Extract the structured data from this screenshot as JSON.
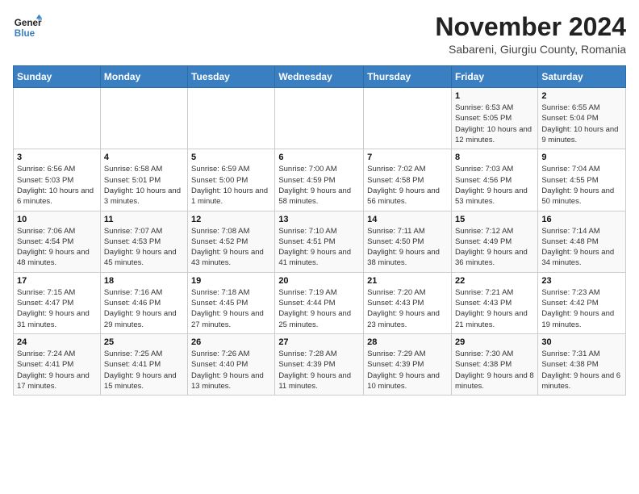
{
  "header": {
    "logo_line1": "General",
    "logo_line2": "Blue",
    "month_title": "November 2024",
    "location": "Sabareni, Giurgiu County, Romania"
  },
  "days_of_week": [
    "Sunday",
    "Monday",
    "Tuesday",
    "Wednesday",
    "Thursday",
    "Friday",
    "Saturday"
  ],
  "weeks": [
    [
      {
        "day": "",
        "info": ""
      },
      {
        "day": "",
        "info": ""
      },
      {
        "day": "",
        "info": ""
      },
      {
        "day": "",
        "info": ""
      },
      {
        "day": "",
        "info": ""
      },
      {
        "day": "1",
        "info": "Sunrise: 6:53 AM\nSunset: 5:05 PM\nDaylight: 10 hours and 12 minutes."
      },
      {
        "day": "2",
        "info": "Sunrise: 6:55 AM\nSunset: 5:04 PM\nDaylight: 10 hours and 9 minutes."
      }
    ],
    [
      {
        "day": "3",
        "info": "Sunrise: 6:56 AM\nSunset: 5:03 PM\nDaylight: 10 hours and 6 minutes."
      },
      {
        "day": "4",
        "info": "Sunrise: 6:58 AM\nSunset: 5:01 PM\nDaylight: 10 hours and 3 minutes."
      },
      {
        "day": "5",
        "info": "Sunrise: 6:59 AM\nSunset: 5:00 PM\nDaylight: 10 hours and 1 minute."
      },
      {
        "day": "6",
        "info": "Sunrise: 7:00 AM\nSunset: 4:59 PM\nDaylight: 9 hours and 58 minutes."
      },
      {
        "day": "7",
        "info": "Sunrise: 7:02 AM\nSunset: 4:58 PM\nDaylight: 9 hours and 56 minutes."
      },
      {
        "day": "8",
        "info": "Sunrise: 7:03 AM\nSunset: 4:56 PM\nDaylight: 9 hours and 53 minutes."
      },
      {
        "day": "9",
        "info": "Sunrise: 7:04 AM\nSunset: 4:55 PM\nDaylight: 9 hours and 50 minutes."
      }
    ],
    [
      {
        "day": "10",
        "info": "Sunrise: 7:06 AM\nSunset: 4:54 PM\nDaylight: 9 hours and 48 minutes."
      },
      {
        "day": "11",
        "info": "Sunrise: 7:07 AM\nSunset: 4:53 PM\nDaylight: 9 hours and 45 minutes."
      },
      {
        "day": "12",
        "info": "Sunrise: 7:08 AM\nSunset: 4:52 PM\nDaylight: 9 hours and 43 minutes."
      },
      {
        "day": "13",
        "info": "Sunrise: 7:10 AM\nSunset: 4:51 PM\nDaylight: 9 hours and 41 minutes."
      },
      {
        "day": "14",
        "info": "Sunrise: 7:11 AM\nSunset: 4:50 PM\nDaylight: 9 hours and 38 minutes."
      },
      {
        "day": "15",
        "info": "Sunrise: 7:12 AM\nSunset: 4:49 PM\nDaylight: 9 hours and 36 minutes."
      },
      {
        "day": "16",
        "info": "Sunrise: 7:14 AM\nSunset: 4:48 PM\nDaylight: 9 hours and 34 minutes."
      }
    ],
    [
      {
        "day": "17",
        "info": "Sunrise: 7:15 AM\nSunset: 4:47 PM\nDaylight: 9 hours and 31 minutes."
      },
      {
        "day": "18",
        "info": "Sunrise: 7:16 AM\nSunset: 4:46 PM\nDaylight: 9 hours and 29 minutes."
      },
      {
        "day": "19",
        "info": "Sunrise: 7:18 AM\nSunset: 4:45 PM\nDaylight: 9 hours and 27 minutes."
      },
      {
        "day": "20",
        "info": "Sunrise: 7:19 AM\nSunset: 4:44 PM\nDaylight: 9 hours and 25 minutes."
      },
      {
        "day": "21",
        "info": "Sunrise: 7:20 AM\nSunset: 4:43 PM\nDaylight: 9 hours and 23 minutes."
      },
      {
        "day": "22",
        "info": "Sunrise: 7:21 AM\nSunset: 4:43 PM\nDaylight: 9 hours and 21 minutes."
      },
      {
        "day": "23",
        "info": "Sunrise: 7:23 AM\nSunset: 4:42 PM\nDaylight: 9 hours and 19 minutes."
      }
    ],
    [
      {
        "day": "24",
        "info": "Sunrise: 7:24 AM\nSunset: 4:41 PM\nDaylight: 9 hours and 17 minutes."
      },
      {
        "day": "25",
        "info": "Sunrise: 7:25 AM\nSunset: 4:41 PM\nDaylight: 9 hours and 15 minutes."
      },
      {
        "day": "26",
        "info": "Sunrise: 7:26 AM\nSunset: 4:40 PM\nDaylight: 9 hours and 13 minutes."
      },
      {
        "day": "27",
        "info": "Sunrise: 7:28 AM\nSunset: 4:39 PM\nDaylight: 9 hours and 11 minutes."
      },
      {
        "day": "28",
        "info": "Sunrise: 7:29 AM\nSunset: 4:39 PM\nDaylight: 9 hours and 10 minutes."
      },
      {
        "day": "29",
        "info": "Sunrise: 7:30 AM\nSunset: 4:38 PM\nDaylight: 9 hours and 8 minutes."
      },
      {
        "day": "30",
        "info": "Sunrise: 7:31 AM\nSunset: 4:38 PM\nDaylight: 9 hours and 6 minutes."
      }
    ]
  ]
}
